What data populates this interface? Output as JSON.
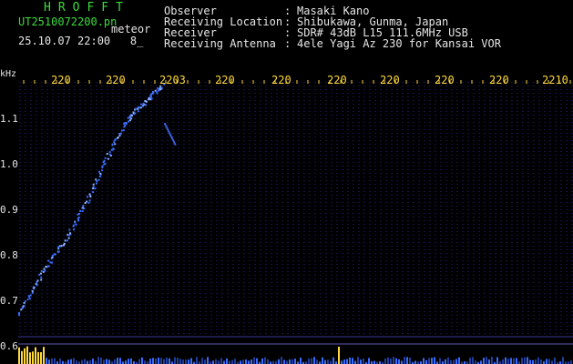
{
  "header": {
    "app_title": "HROFFT",
    "filename": "UT2510072200.pn",
    "meteor_label": "meteor",
    "datetime": "25.10.07 22:00",
    "extra": "8_"
  },
  "info": [
    {
      "key": "Observer",
      "colon": ":",
      "value": "Masaki Kano"
    },
    {
      "key": "Receiving Location",
      "colon": ":",
      "value": "Shibukawa, Gunma, Japan"
    },
    {
      "key": "Receiver",
      "colon": ":",
      "value": "SDR# 43dB L15 111.6MHz USB"
    },
    {
      "key": "Receiving Antenna",
      "colon": ":",
      "value": "4ele Yagi Az 230 for Kansai VOR"
    }
  ],
  "axes": {
    "y_unit": "kHz",
    "y_ticks": [
      "1.1",
      "1.0",
      "0.9",
      "0.8",
      "0.7",
      "0.6"
    ],
    "x_ticks": [
      "220",
      "220",
      "2203",
      "220",
      "220",
      "220",
      "220",
      "220",
      "220",
      "2210"
    ]
  },
  "colors": {
    "background": "#000000",
    "grid": "#2a2a8a",
    "trail": "#3a6cff",
    "ticks_x": "#ffd83a",
    "text_green": "#3ddc3d",
    "text_white": "#e6e6e6"
  }
}
